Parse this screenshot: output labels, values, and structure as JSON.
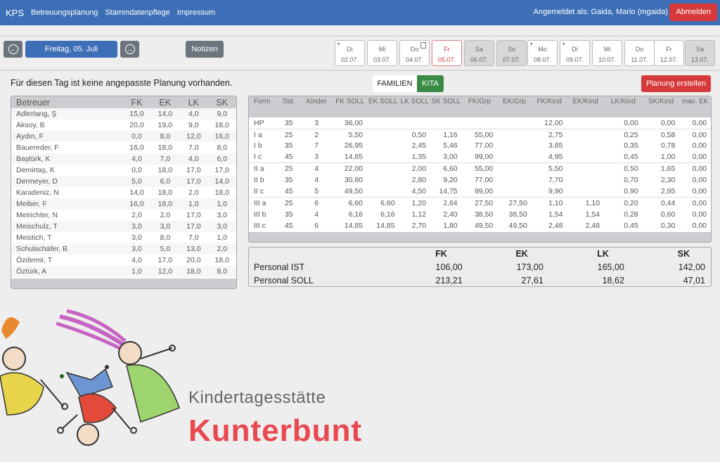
{
  "nav": {
    "brand": "KPS",
    "links": [
      "Betreuungsplanung",
      "Stammdatenpflege",
      "Impressum"
    ],
    "user_text": "Angemeldet als: Gaida, Mario (mgaida)",
    "logout": "Abmelden"
  },
  "datebar": {
    "prev_icon": "arrow-left-circle-icon",
    "next_icon": "arrow-right-circle-icon",
    "prev_glyph": "←",
    "next_glyph": "→",
    "date_label": "Freitag, 05. Juli",
    "notes_label": "Notizen",
    "days": [
      {
        "day": "Di",
        "date": "02.07.",
        "star": "*",
        "weekend": false,
        "current": false,
        "note": false
      },
      {
        "day": "Mi",
        "date": "03.07.",
        "star": "",
        "weekend": false,
        "current": false,
        "note": false
      },
      {
        "day": "Do",
        "date": "04.07.",
        "star": "",
        "weekend": false,
        "current": false,
        "note": true
      },
      {
        "day": "Fr",
        "date": "05.07.",
        "star": "",
        "weekend": false,
        "current": true,
        "note": false
      },
      {
        "day": "Sa",
        "date": "06.07.",
        "star": "",
        "weekend": true,
        "current": false,
        "note": false
      },
      {
        "day": "So",
        "date": "07.07.",
        "star": "",
        "weekend": true,
        "current": false,
        "note": false
      },
      {
        "day": "Mo",
        "date": "08.07.",
        "star": "*",
        "weekend": false,
        "current": false,
        "note": false
      },
      {
        "day": "Di",
        "date": "09.07.",
        "star": "*",
        "weekend": false,
        "current": false,
        "note": false
      },
      {
        "day": "Mi",
        "date": "10.07.",
        "star": "",
        "weekend": false,
        "current": false,
        "note": false
      },
      {
        "day": "Do",
        "date": "11.07.",
        "star": "",
        "weekend": false,
        "current": false,
        "note": false
      },
      {
        "day": "Fr",
        "date": "12.07.",
        "star": "",
        "weekend": false,
        "current": false,
        "note": false
      },
      {
        "day": "Sa",
        "date": "13.07.",
        "star": "",
        "weekend": true,
        "current": false,
        "note": false
      }
    ]
  },
  "message": "Für diesen Tag ist keine angepasste Planung vorhanden.",
  "toggle": {
    "familien": "FAMILIEN",
    "kita": "KITA",
    "active": "kita"
  },
  "create_plan": "Planung erstellen",
  "betreuer": {
    "headers": [
      "Betreuer",
      "FK",
      "EK",
      "LK",
      "SK"
    ],
    "rows": [
      [
        "Adlerlang, Ş",
        "15,0",
        "14,0",
        "4,0",
        "9,0"
      ],
      [
        "Aksoy, B",
        "20,0",
        "19,0",
        "9,0",
        "18,0"
      ],
      [
        "Aydın, F",
        "0,0",
        "8,0",
        "12,0",
        "16,0"
      ],
      [
        "Bauereder, F",
        "16,0",
        "18,0",
        "7,0",
        "8,0"
      ],
      [
        "Baştürk, K",
        "4,0",
        "7,0",
        "4,0",
        "6,0"
      ],
      [
        "Demirtaş, K",
        "0,0",
        "18,0",
        "17,0",
        "17,0"
      ],
      [
        "Dermeyer, D",
        "5,0",
        "6,0",
        "17,0",
        "14,0"
      ],
      [
        "Karadeniz, N",
        "14,0",
        "18,0",
        "2,0",
        "18,0"
      ],
      [
        "Meiber, F",
        "16,0",
        "18,0",
        "1,0",
        "1,0"
      ],
      [
        "Meirichter, N",
        "2,0",
        "2,0",
        "17,0",
        "3,0"
      ],
      [
        "Meischulz, T",
        "3,0",
        "3,0",
        "17,0",
        "3,0"
      ],
      [
        "Meistich, T",
        "3,0",
        "8,0",
        "7,0",
        "1,0"
      ],
      [
        "Schulschäfer, B",
        "3,0",
        "5,0",
        "13,0",
        "2,0"
      ],
      [
        "Özdemir, T",
        "4,0",
        "17,0",
        "20,0",
        "18,0"
      ],
      [
        "Öztürk, A",
        "1,0",
        "12,0",
        "18,0",
        "8,0"
      ]
    ]
  },
  "kita": {
    "headers": [
      "Form",
      "Std.",
      "Kinder",
      "FK SOLL",
      "EK SOLL",
      "LK SOLL",
      "SK SOLL",
      "FK/Grp",
      "EK/Grp",
      "FK/Kind",
      "EK/Kind",
      "LK/Kind",
      "SK/Kind",
      "max. EK"
    ],
    "rows": [
      [
        "HP",
        "35",
        "3",
        "36,00",
        "",
        "",
        "",
        "",
        "",
        "12,00",
        "",
        "0,00",
        "0,00",
        "0,00"
      ],
      [
        "I a",
        "25",
        "2",
        "5,50",
        "",
        "0,50",
        "1,16",
        "55,00",
        "",
        "2,75",
        "",
        "0,25",
        "0,58",
        "0,00"
      ],
      [
        "I b",
        "35",
        "7",
        "26,95",
        "",
        "2,45",
        "5,46",
        "77,00",
        "",
        "3,85",
        "",
        "0,35",
        "0,78",
        "0,00"
      ],
      [
        "I c",
        "45",
        "3",
        "14,85",
        "",
        "1,35",
        "3,00",
        "99,00",
        "",
        "4,95",
        "",
        "0,45",
        "1,00",
        "0,00"
      ],
      [
        "II a",
        "25",
        "4",
        "22,00",
        "",
        "2,00",
        "6,60",
        "55,00",
        "",
        "5,50",
        "",
        "0,50",
        "1,65",
        "0,00"
      ],
      [
        "II b",
        "35",
        "4",
        "30,80",
        "",
        "2,80",
        "9,20",
        "77,00",
        "",
        "7,70",
        "",
        "0,70",
        "2,30",
        "0,00"
      ],
      [
        "II c",
        "45",
        "5",
        "49,50",
        "",
        "4,50",
        "14,75",
        "99,00",
        "",
        "9,90",
        "",
        "0,90",
        "2,95",
        "0,00"
      ],
      [
        "III a",
        "25",
        "6",
        "6,60",
        "6,60",
        "1,20",
        "2,64",
        "27,50",
        "27,50",
        "1,10",
        "1,10",
        "0,20",
        "0,44",
        "0,00"
      ],
      [
        "III b",
        "35",
        "4",
        "6,16",
        "6,16",
        "1,12",
        "2,40",
        "38,50",
        "38,50",
        "1,54",
        "1,54",
        "0,28",
        "0,60",
        "0,00"
      ],
      [
        "III c",
        "45",
        "6",
        "14,85",
        "14,85",
        "2,70",
        "1,80",
        "49,50",
        "49,50",
        "2,48",
        "2,48",
        "0,45",
        "0,30",
        "0,00"
      ]
    ]
  },
  "summary": {
    "headers": [
      "",
      "FK",
      "EK",
      "LK",
      "SK"
    ],
    "rows": [
      [
        "Personal IST",
        "106,00",
        "173,00",
        "165,00",
        "142,00"
      ],
      [
        "Personal SOLL",
        "213,21",
        "27,61",
        "18,62",
        "47,01"
      ]
    ]
  },
  "logo": {
    "subtitle": "Kindertagesstätte",
    "title": "Kunterbunt"
  }
}
